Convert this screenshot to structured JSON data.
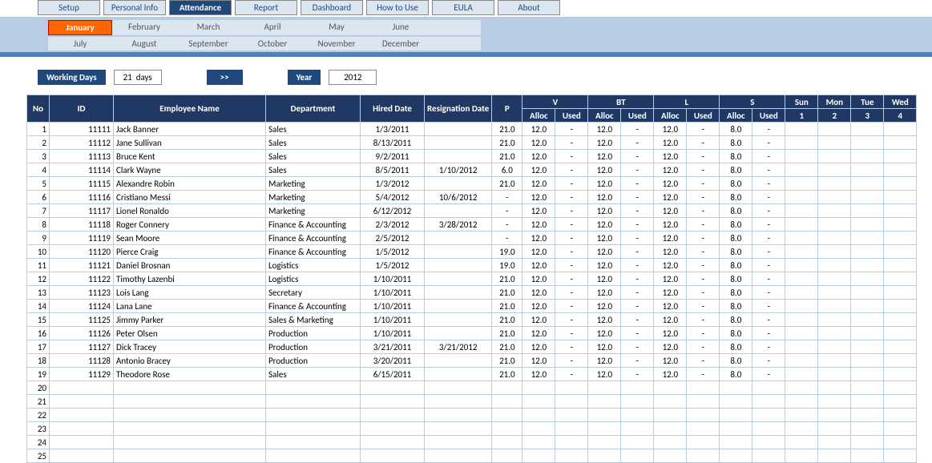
{
  "tabs": [
    "Setup",
    "Personal Info",
    "Attendance",
    "Report",
    "Dashboard",
    "How to Use",
    "EULA",
    "About"
  ],
  "active_tab": "Attendance",
  "months_row1": [
    "January",
    "February",
    "March",
    "April",
    "May",
    "June"
  ],
  "months_row2": [
    "July",
    "August",
    "September",
    "October",
    "November",
    "December"
  ],
  "active_month": "January",
  "working_days_label": "Working Days",
  "working_days_value": "21",
  "working_days_unit": "days",
  "arrow_label": ">>",
  "year_label": "Year",
  "year_value": "2012",
  "headers": {
    "no": "No",
    "id": "ID",
    "name": "Employee Name",
    "dept": "Department",
    "hired": "Hired Date",
    "resign": "Resignation Date",
    "p": "P",
    "v": "V",
    "bt": "BT",
    "l": "L",
    "s": "S",
    "alloc": "Alloc",
    "used": "Used",
    "days": [
      "Sun",
      "Mon",
      "Tue",
      "Wed"
    ],
    "daynums": [
      "1",
      "2",
      "3",
      "4"
    ]
  },
  "rows": [
    {
      "no": 1,
      "id": "11111",
      "name": "Jack Banner",
      "dept": "Sales",
      "hired": "1/3/2011",
      "resign": "",
      "p": "21.0",
      "v_a": "12.0",
      "v_u": "-",
      "bt_a": "12.0",
      "bt_u": "-",
      "l_a": "12.0",
      "l_u": "-",
      "s_a": "8.0",
      "s_u": "-",
      "d": [
        "r",
        "r",
        "",
        ""
      ]
    },
    {
      "no": 2,
      "id": "11112",
      "name": "Jane Sullivan",
      "dept": "Sales",
      "hired": "8/13/2011",
      "resign": "",
      "p": "21.0",
      "v_a": "12.0",
      "v_u": "-",
      "bt_a": "12.0",
      "bt_u": "-",
      "l_a": "12.0",
      "l_u": "-",
      "s_a": "8.0",
      "s_u": "-",
      "d": [
        "r",
        "r",
        "",
        ""
      ]
    },
    {
      "no": 3,
      "id": "11113",
      "name": "Bruce Kent",
      "dept": "Sales",
      "hired": "9/2/2011",
      "resign": "",
      "p": "21.0",
      "v_a": "12.0",
      "v_u": "-",
      "bt_a": "12.0",
      "bt_u": "-",
      "l_a": "12.0",
      "l_u": "-",
      "s_a": "8.0",
      "s_u": "-",
      "d": [
        "r",
        "r",
        "",
        ""
      ]
    },
    {
      "no": 4,
      "id": "11114",
      "name": "Clark Wayne",
      "dept": "Sales",
      "hired": "8/5/2011",
      "resign": "1/10/2012",
      "p": "6.0",
      "v_a": "12.0",
      "v_u": "-",
      "bt_a": "12.0",
      "bt_u": "-",
      "l_a": "12.0",
      "l_u": "-",
      "s_a": "8.0",
      "s_u": "-",
      "d": [
        "r",
        "r",
        "",
        ""
      ]
    },
    {
      "no": 5,
      "id": "11115",
      "name": "Alexandre Robin",
      "dept": "Marketing",
      "hired": "1/3/2012",
      "resign": "",
      "p": "21.0",
      "v_a": "12.0",
      "v_u": "-",
      "bt_a": "12.0",
      "bt_u": "-",
      "l_a": "12.0",
      "l_u": "-",
      "s_a": "8.0",
      "s_u": "-",
      "d": [
        "r",
        "r",
        "",
        ""
      ]
    },
    {
      "no": 6,
      "id": "11116",
      "name": "Cristiano Messi",
      "dept": "Marketing",
      "hired": "5/4/2012",
      "resign": "10/6/2012",
      "p": "-",
      "v_a": "12.0",
      "v_u": "-",
      "bt_a": "12.0",
      "bt_u": "-",
      "l_a": "12.0",
      "l_u": "-",
      "s_a": "8.0",
      "s_u": "-",
      "d": [
        "r",
        "r",
        "g",
        "g"
      ]
    },
    {
      "no": 7,
      "id": "11117",
      "name": "Lionel Ronaldo",
      "dept": "Marketing",
      "hired": "6/12/2012",
      "resign": "",
      "p": "-",
      "v_a": "12.0",
      "v_u": "-",
      "bt_a": "12.0",
      "bt_u": "-",
      "l_a": "12.0",
      "l_u": "-",
      "s_a": "8.0",
      "s_u": "-",
      "d": [
        "r",
        "r",
        "g",
        "g"
      ]
    },
    {
      "no": 8,
      "id": "11118",
      "name": "Roger Connery",
      "dept": "Finance & Accounting",
      "hired": "2/3/2012",
      "resign": "3/28/2012",
      "p": "-",
      "v_a": "12.0",
      "v_u": "-",
      "bt_a": "12.0",
      "bt_u": "-",
      "l_a": "12.0",
      "l_u": "-",
      "s_a": "8.0",
      "s_u": "-",
      "d": [
        "r",
        "r",
        "g",
        "g"
      ]
    },
    {
      "no": 9,
      "id": "11119",
      "name": "Sean Moore",
      "dept": "Finance & Accounting",
      "hired": "2/5/2012",
      "resign": "",
      "p": "-",
      "v_a": "12.0",
      "v_u": "-",
      "bt_a": "12.0",
      "bt_u": "-",
      "l_a": "12.0",
      "l_u": "-",
      "s_a": "8.0",
      "s_u": "-",
      "d": [
        "r",
        "r",
        "g",
        "g"
      ]
    },
    {
      "no": 10,
      "id": "11120",
      "name": "Pierce Craig",
      "dept": "Finance & Accounting",
      "hired": "1/5/2012",
      "resign": "",
      "p": "19.0",
      "v_a": "12.0",
      "v_u": "-",
      "bt_a": "12.0",
      "bt_u": "-",
      "l_a": "12.0",
      "l_u": "-",
      "s_a": "8.0",
      "s_u": "-",
      "d": [
        "r",
        "r",
        "g",
        "g"
      ]
    },
    {
      "no": 11,
      "id": "11121",
      "name": "Daniel Brosnan",
      "dept": "Logistics",
      "hired": "1/5/2012",
      "resign": "",
      "p": "19.0",
      "v_a": "12.0",
      "v_u": "-",
      "bt_a": "12.0",
      "bt_u": "-",
      "l_a": "12.0",
      "l_u": "-",
      "s_a": "8.0",
      "s_u": "-",
      "d": [
        "r",
        "r",
        "g",
        "g"
      ]
    },
    {
      "no": 12,
      "id": "11122",
      "name": "Timothy Lazenbi",
      "dept": "Logistics",
      "hired": "1/10/2011",
      "resign": "",
      "p": "21.0",
      "v_a": "12.0",
      "v_u": "-",
      "bt_a": "12.0",
      "bt_u": "-",
      "l_a": "12.0",
      "l_u": "-",
      "s_a": "8.0",
      "s_u": "-",
      "d": [
        "r",
        "r",
        "",
        ""
      ]
    },
    {
      "no": 13,
      "id": "11123",
      "name": "Lois Lang",
      "dept": "Secretary",
      "hired": "1/10/2011",
      "resign": "",
      "p": "21.0",
      "v_a": "12.0",
      "v_u": "-",
      "bt_a": "12.0",
      "bt_u": "-",
      "l_a": "12.0",
      "l_u": "-",
      "s_a": "8.0",
      "s_u": "-",
      "d": [
        "r",
        "r",
        "",
        ""
      ]
    },
    {
      "no": 14,
      "id": "11124",
      "name": "Lana Lane",
      "dept": "Finance & Accounting",
      "hired": "1/10/2011",
      "resign": "",
      "p": "21.0",
      "v_a": "12.0",
      "v_u": "-",
      "bt_a": "12.0",
      "bt_u": "-",
      "l_a": "12.0",
      "l_u": "-",
      "s_a": "8.0",
      "s_u": "-",
      "d": [
        "r",
        "r",
        "",
        ""
      ]
    },
    {
      "no": 15,
      "id": "11125",
      "name": "Jimmy Parker",
      "dept": "Sales & Marketing",
      "hired": "1/10/2011",
      "resign": "",
      "p": "21.0",
      "v_a": "12.0",
      "v_u": "-",
      "bt_a": "12.0",
      "bt_u": "-",
      "l_a": "12.0",
      "l_u": "-",
      "s_a": "8.0",
      "s_u": "-",
      "d": [
        "r",
        "r",
        "",
        ""
      ]
    },
    {
      "no": 16,
      "id": "11126",
      "name": "Peter Olsen",
      "dept": "Production",
      "hired": "1/10/2011",
      "resign": "",
      "p": "21.0",
      "v_a": "12.0",
      "v_u": "-",
      "bt_a": "12.0",
      "bt_u": "-",
      "l_a": "12.0",
      "l_u": "-",
      "s_a": "8.0",
      "s_u": "-",
      "d": [
        "r",
        "r",
        "",
        ""
      ]
    },
    {
      "no": 17,
      "id": "11127",
      "name": "Dick Tracey",
      "dept": "Production",
      "hired": "3/21/2011",
      "resign": "3/21/2012",
      "p": "21.0",
      "v_a": "12.0",
      "v_u": "-",
      "bt_a": "12.0",
      "bt_u": "-",
      "l_a": "12.0",
      "l_u": "-",
      "s_a": "8.0",
      "s_u": "-",
      "d": [
        "r",
        "r",
        "",
        ""
      ]
    },
    {
      "no": 18,
      "id": "11128",
      "name": "Antonio Bracey",
      "dept": "Production",
      "hired": "3/20/2011",
      "resign": "",
      "p": "21.0",
      "v_a": "12.0",
      "v_u": "-",
      "bt_a": "12.0",
      "bt_u": "-",
      "l_a": "12.0",
      "l_u": "-",
      "s_a": "8.0",
      "s_u": "-",
      "d": [
        "r",
        "r",
        "",
        ""
      ]
    },
    {
      "no": 19,
      "id": "11129",
      "name": "Theodore Rose",
      "dept": "Sales",
      "hired": "6/15/2011",
      "resign": "",
      "p": "21.0",
      "v_a": "12.0",
      "v_u": "-",
      "bt_a": "12.0",
      "bt_u": "-",
      "l_a": "12.0",
      "l_u": "-",
      "s_a": "8.0",
      "s_u": "-",
      "d": [
        "r",
        "r",
        "",
        ""
      ]
    },
    {
      "no": 20,
      "id": "",
      "name": "",
      "dept": "",
      "hired": "",
      "resign": "",
      "p": "",
      "v_a": "",
      "v_u": "",
      "bt_a": "",
      "bt_u": "",
      "l_a": "",
      "l_u": "",
      "s_a": "",
      "s_u": "",
      "d": [
        "r",
        "r",
        "",
        ""
      ]
    },
    {
      "no": 21,
      "id": "",
      "name": "",
      "dept": "",
      "hired": "",
      "resign": "",
      "p": "",
      "v_a": "",
      "v_u": "",
      "bt_a": "",
      "bt_u": "",
      "l_a": "",
      "l_u": "",
      "s_a": "",
      "s_u": "",
      "d": [
        "r",
        "r",
        "",
        ""
      ]
    },
    {
      "no": 22,
      "id": "",
      "name": "",
      "dept": "",
      "hired": "",
      "resign": "",
      "p": "",
      "v_a": "",
      "v_u": "",
      "bt_a": "",
      "bt_u": "",
      "l_a": "",
      "l_u": "",
      "s_a": "",
      "s_u": "",
      "d": [
        "r",
        "r",
        "",
        ""
      ]
    },
    {
      "no": 23,
      "id": "",
      "name": "",
      "dept": "",
      "hired": "",
      "resign": "",
      "p": "",
      "v_a": "",
      "v_u": "",
      "bt_a": "",
      "bt_u": "",
      "l_a": "",
      "l_u": "",
      "s_a": "",
      "s_u": "",
      "d": [
        "r",
        "r",
        "",
        ""
      ]
    },
    {
      "no": 24,
      "id": "",
      "name": "",
      "dept": "",
      "hired": "",
      "resign": "",
      "p": "",
      "v_a": "",
      "v_u": "",
      "bt_a": "",
      "bt_u": "",
      "l_a": "",
      "l_u": "",
      "s_a": "",
      "s_u": "",
      "d": [
        "r",
        "r",
        "",
        ""
      ]
    },
    {
      "no": 25,
      "id": "",
      "name": "",
      "dept": "",
      "hired": "",
      "resign": "",
      "p": "",
      "v_a": "",
      "v_u": "",
      "bt_a": "",
      "bt_u": "",
      "l_a": "",
      "l_u": "",
      "s_a": "",
      "s_u": "",
      "d": [
        "r",
        "r",
        "",
        ""
      ]
    }
  ]
}
